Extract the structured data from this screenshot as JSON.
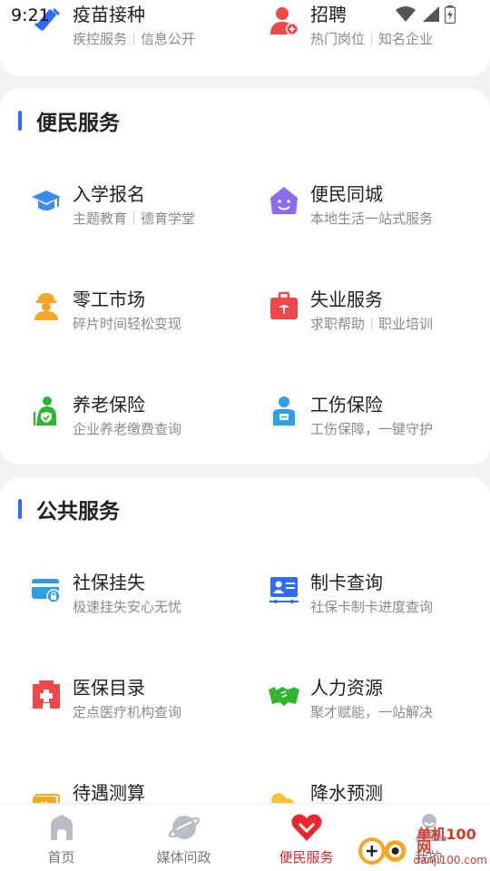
{
  "status_bar": {
    "time": "9:21"
  },
  "top_section": {
    "items": [
      {
        "title": "疫苗接种",
        "subs": [
          "疾控服务",
          "信息公开"
        ],
        "icon": "syringe-icon"
      },
      {
        "title": "招聘",
        "subs": [
          "热门岗位",
          "知名企业"
        ],
        "icon": "person-add-icon"
      }
    ]
  },
  "section_convenience": {
    "title": "便民服务",
    "items": [
      {
        "title": "入学报名",
        "subs": [
          "主题教育",
          "德育学堂"
        ],
        "icon": "graduation-cap-icon"
      },
      {
        "title": "便民同城",
        "subs": [
          "本地生活一站式服务"
        ],
        "icon": "house-smile-icon"
      },
      {
        "title": "零工市场",
        "subs": [
          "碎片时间轻松变现"
        ],
        "icon": "worker-icon"
      },
      {
        "title": "失业服务",
        "subs": [
          "求职帮助",
          "职业培训"
        ],
        "icon": "briefcase-icon"
      },
      {
        "title": "养老保险",
        "subs": [
          "企业养老缴费查询"
        ],
        "icon": "elderly-shield-icon"
      },
      {
        "title": "工伤保险",
        "subs": [
          "工伤保障，一键守护"
        ],
        "icon": "injured-person-icon"
      }
    ]
  },
  "section_public": {
    "title": "公共服务",
    "items": [
      {
        "title": "社保挂失",
        "subs": [
          "极速挂失安心无忧"
        ],
        "icon": "card-lock-icon"
      },
      {
        "title": "制卡查询",
        "subs": [
          "社保卡制卡进度查询"
        ],
        "icon": "id-card-icon"
      },
      {
        "title": "医保目录",
        "subs": [
          "定点医疗机构查询"
        ],
        "icon": "hospital-icon"
      },
      {
        "title": "人力资源",
        "subs": [
          "聚才赋能，一站解决"
        ],
        "icon": "handshake-icon"
      },
      {
        "title": "待遇测算",
        "subs": [],
        "icon": "calculator-icon"
      },
      {
        "title": "降水预测",
        "subs": [],
        "icon": "weather-icon"
      }
    ]
  },
  "tabbar": {
    "tabs": [
      {
        "label": "首页",
        "icon": "home-icon",
        "active": false
      },
      {
        "label": "媒体问政",
        "icon": "planet-icon",
        "active": false
      },
      {
        "label": "便民服务",
        "icon": "heart-hands-icon",
        "active": true
      },
      {
        "label": "我的",
        "icon": "user-icon",
        "active": false
      }
    ]
  },
  "watermark": {
    "text": "单机100网",
    "sub": "danji100.com"
  },
  "colors": {
    "accent": "#2f6bff",
    "active_tab": "#e8262e"
  }
}
